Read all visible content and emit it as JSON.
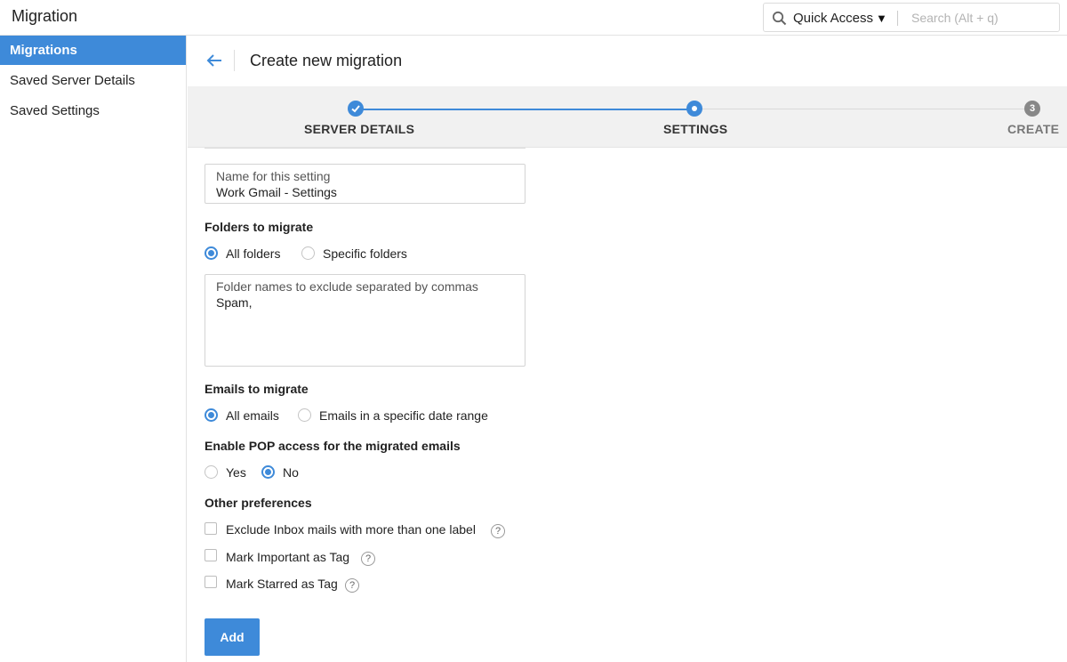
{
  "app": {
    "title": "Migration"
  },
  "quick_access": {
    "label": "Quick Access",
    "search_placeholder": "Search (Alt + q)"
  },
  "sidebar": {
    "items": [
      {
        "label": "Migrations",
        "active": true
      },
      {
        "label": "Saved Server Details",
        "active": false
      },
      {
        "label": "Saved Settings",
        "active": false
      }
    ]
  },
  "main": {
    "title": "Create new migration",
    "steps": [
      {
        "label": "SERVER DETAILS",
        "state": "done"
      },
      {
        "label": "SETTINGS",
        "state": "current"
      },
      {
        "label": "CREATE",
        "state": "pending",
        "number": "3"
      }
    ],
    "setting_name": {
      "label": "Name for this setting",
      "value": "Work Gmail - Settings"
    },
    "folders": {
      "title": "Folders to migrate",
      "options": [
        "All folders",
        "Specific folders"
      ],
      "selected": "All folders",
      "exclude_label": "Folder names to exclude separated by commas",
      "exclude_value": "Spam,"
    },
    "emails": {
      "title": "Emails to migrate",
      "options": [
        "All emails",
        "Emails in a specific date range"
      ],
      "selected": "All emails"
    },
    "pop": {
      "title": "Enable POP access for the migrated emails",
      "options": [
        "Yes",
        "No"
      ],
      "selected": "No"
    },
    "preferences": {
      "title": "Other preferences",
      "items": [
        {
          "label": "Exclude Inbox mails with more than one label",
          "checked": false
        },
        {
          "label": "Mark Important as Tag",
          "checked": false
        },
        {
          "label": "Mark Starred as Tag",
          "checked": false
        }
      ],
      "help_glyph": "?"
    },
    "add_label": "Add"
  },
  "colors": {
    "accent": "#3e8ad9",
    "sidebar_active_bg": "#3e8ad9",
    "stepper_bg": "#f1f1f1"
  }
}
